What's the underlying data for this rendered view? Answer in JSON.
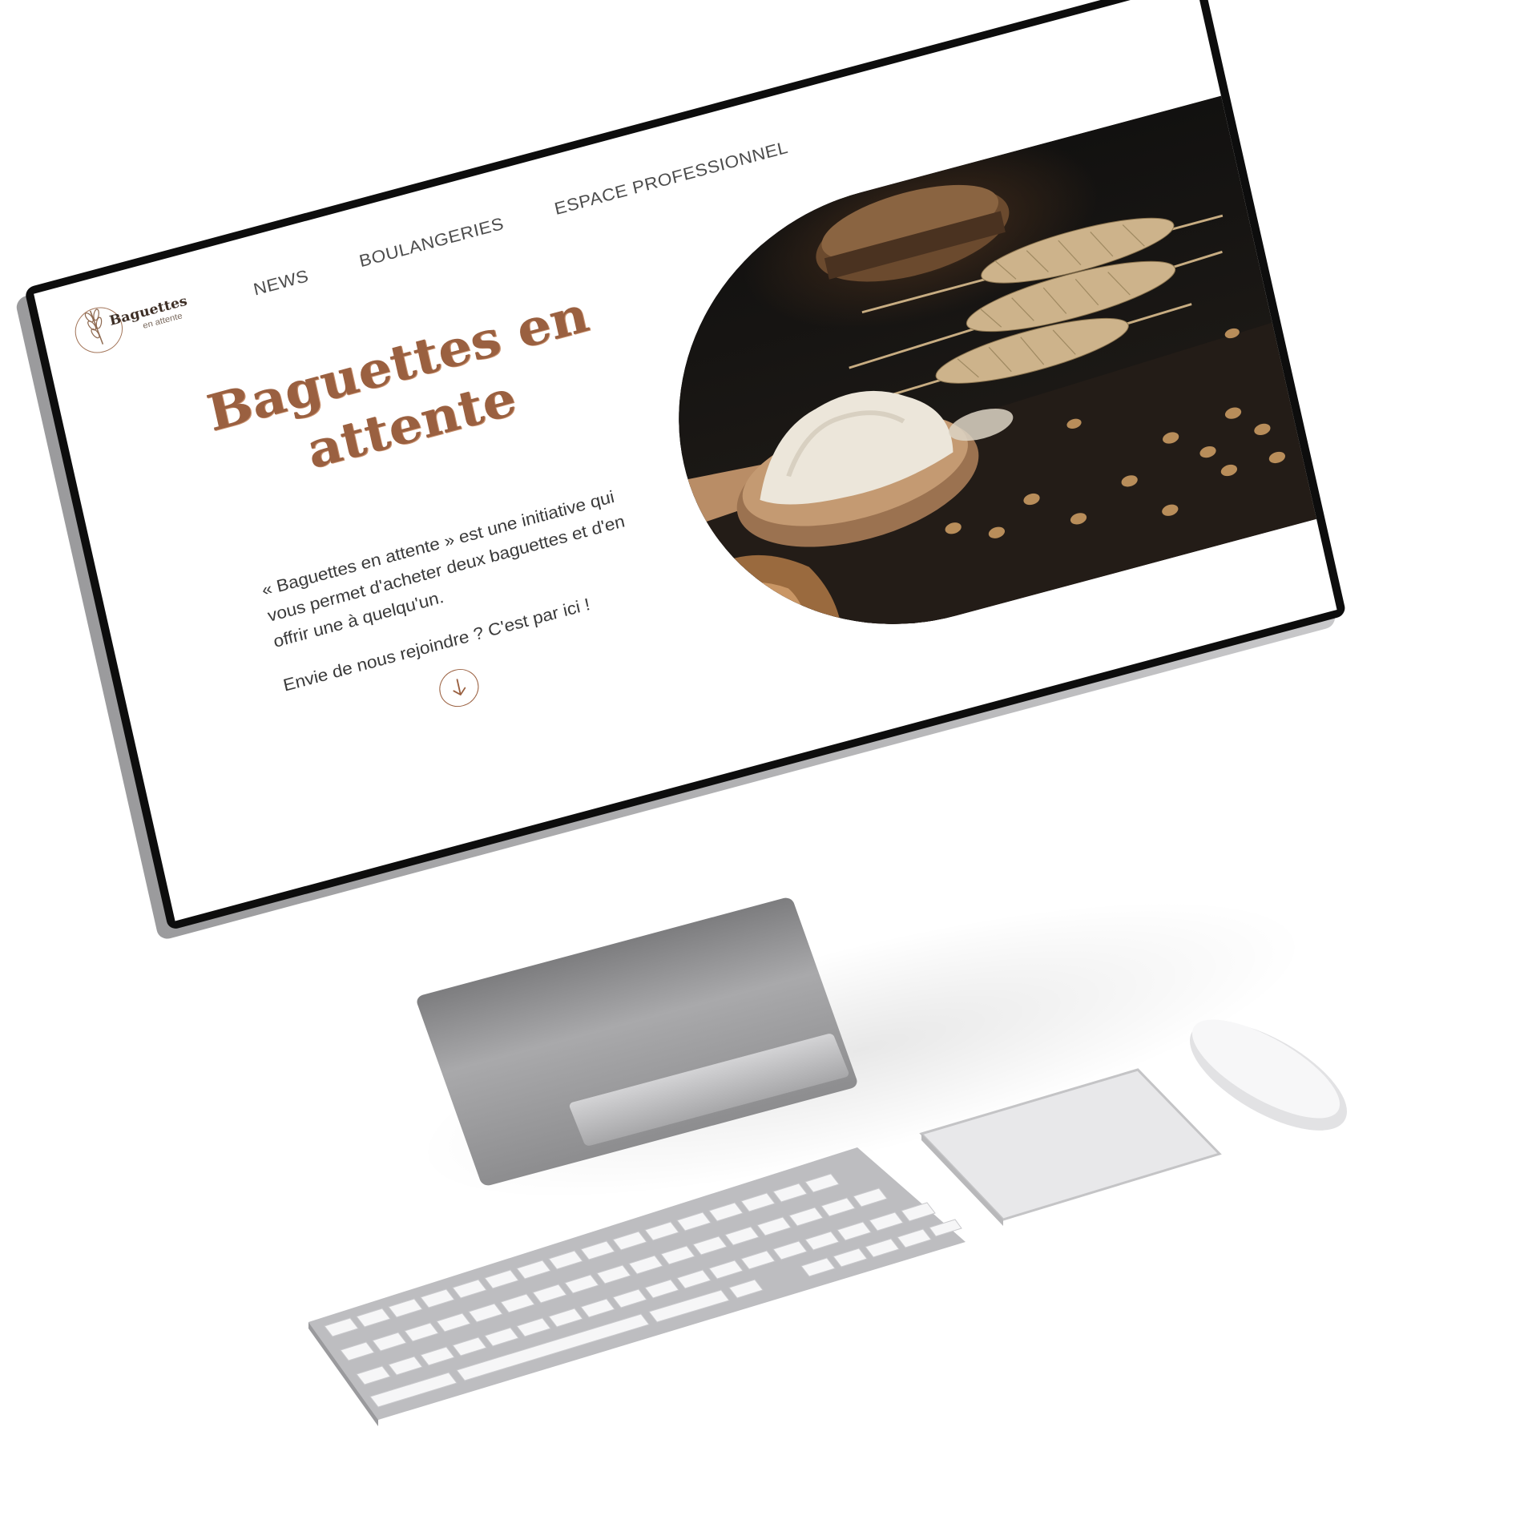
{
  "site": {
    "logo": {
      "name": "Baguettes",
      "tagline": "en attente",
      "icon": "wheat-icon"
    },
    "nav": [
      {
        "label": "NEWS"
      },
      {
        "label": "BOULANGERIES"
      },
      {
        "label": "ESPACE PROFESSIONNEL"
      }
    ],
    "hero": {
      "title_line1": "Baguettes en",
      "title_line2": "attente",
      "description": "« Baguettes en attente » est une initiative qui vous permet d'acheter deux baguettes et d'en offrir une à quelqu'un.",
      "cta": "Envie de nous rejoindre ? C'est par ici !",
      "scroll_icon": "arrow-down-icon"
    }
  },
  "colors": {
    "accent": "#9a6040",
    "text": "#3a3a3a",
    "nav_text": "#4c4c4c",
    "photo_background": "#1c1713",
    "flour": "#ece6da",
    "spoon": "#b98d66",
    "wheat": "#c8ad82"
  }
}
